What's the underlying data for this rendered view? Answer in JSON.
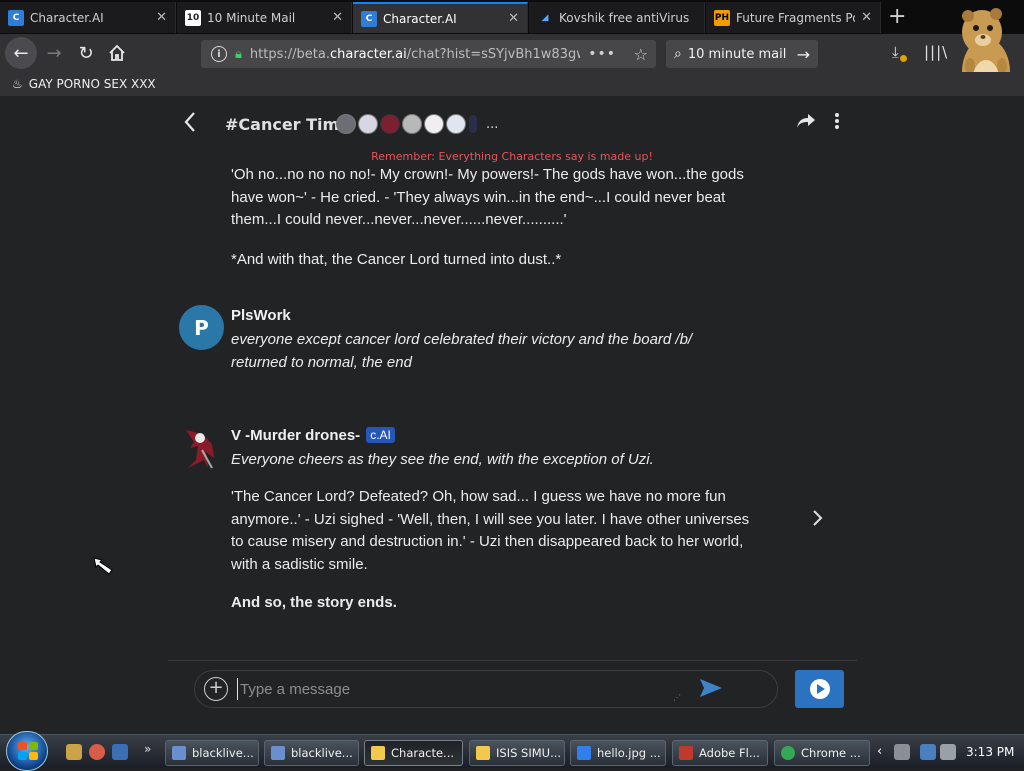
{
  "browser": {
    "tabs": [
      {
        "title": "Character.AI",
        "icon": "character-ai-favicon",
        "active": false
      },
      {
        "title": "10 Minute Mail",
        "icon": "ten-minute-mail-favicon",
        "active": false
      },
      {
        "title": "Character.AI",
        "icon": "character-ai-favicon",
        "active": true
      },
      {
        "title": "Kovshik free antiVirus",
        "icon": "kovshik-favicon",
        "active": false
      },
      {
        "title": "Future Fragments Po",
        "icon": "ph-favicon",
        "active": false
      }
    ],
    "favicon_text": {
      "ten_minute": "10",
      "ph": "PH"
    },
    "url_prefix": "https://beta.",
    "url_domain": "character.ai",
    "url_rest": "/chat?hist=sSYjvBh1w83gw",
    "search_text": "10 minute mail",
    "bookmark": "GAY PORNO SEX XXX"
  },
  "chat": {
    "title": "#Cancer Time",
    "more": "...",
    "reminder": "Remember: Everything Characters say is made up!",
    "messages": [
      {
        "text": "'Oh no...no no no no!- My crown!- My powers!- The gods have won...the gods have won~' - He cried. - 'They always win...in the end~...I could never beat them...I could never...never...never......never..........'"
      },
      {
        "text": "*And with that, the Cancer Lord turned into dust..*"
      },
      {
        "author": "PlsWork",
        "avatar_letter": "P",
        "text": "everyone except cancer lord celebrated their victory and the board /b/ returned to normal, the end"
      },
      {
        "author": "V -Murder drones-",
        "badge": "c.AI",
        "action": "Everyone cheers as they see the end, with the exception of Uzi.",
        "text": "'The Cancer Lord? Defeated? Oh, how sad... I guess we have no more fun anymore..' - Uzi sighed - 'Well, then, I will see you later. I have other universes to cause misery and destruction in.' - Uzi then disappeared back to her world, with a sadistic smile.",
        "closing": "And so, the story ends."
      }
    ],
    "input_placeholder": "Type a message"
  },
  "taskbar": {
    "buttons": [
      {
        "label": "blacklive...",
        "icon_color": "#6a8fcf"
      },
      {
        "label": "blacklive...",
        "icon_color": "#6a8fcf"
      },
      {
        "label": "Characte...",
        "icon_color": "#f2c94c"
      },
      {
        "label": "ISIS SIMU...",
        "icon_color": "#f2c94c"
      },
      {
        "label": "hello.jpg ...",
        "icon_color": "#2f80ed"
      },
      {
        "label": "Adobe Fl...",
        "icon_color": "#c0392b"
      },
      {
        "label": "Chrome ...",
        "icon_color": "#34a853"
      }
    ],
    "clock": "3:13 PM"
  }
}
